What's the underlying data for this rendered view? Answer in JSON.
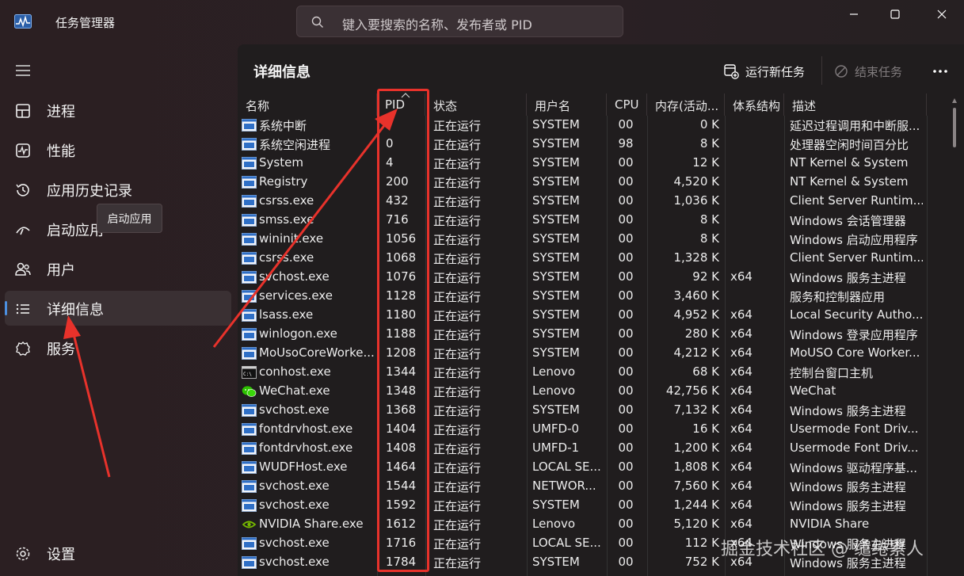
{
  "app": {
    "title": "任务管理器",
    "search_placeholder": "键入要搜索的名称、发布者或 PID"
  },
  "sidebar": {
    "items": [
      {
        "label": "进程",
        "icon": "processes-icon"
      },
      {
        "label": "性能",
        "icon": "performance-icon"
      },
      {
        "label": "应用历史记录",
        "icon": "app-history-icon"
      },
      {
        "label": "启动应用",
        "icon": "startup-icon"
      },
      {
        "label": "用户",
        "icon": "users-icon"
      },
      {
        "label": "详细信息",
        "icon": "details-icon",
        "active": true
      },
      {
        "label": "服务",
        "icon": "services-icon"
      }
    ],
    "settings_label": "设置",
    "tooltip": "启动应用"
  },
  "main": {
    "title": "详细信息",
    "run_task_label": "运行新任务",
    "end_task_label": "结束任务"
  },
  "table": {
    "columns": [
      "名称",
      "PID",
      "状态",
      "用户名",
      "CPU",
      "内存(活动...",
      "体系结构",
      "描述"
    ],
    "rows": [
      {
        "name": "系统中断",
        "pid": "",
        "status": "正在运行",
        "user": "SYSTEM",
        "cpu": "00",
        "mem": "0 K",
        "arch": "",
        "desc": "延迟过程调用和中断服...",
        "icon": "blue"
      },
      {
        "name": "系统空闲进程",
        "pid": "0",
        "status": "正在运行",
        "user": "SYSTEM",
        "cpu": "98",
        "mem": "8 K",
        "arch": "",
        "desc": "处理器空闲时间百分比",
        "icon": "blue"
      },
      {
        "name": "System",
        "pid": "4",
        "status": "正在运行",
        "user": "SYSTEM",
        "cpu": "00",
        "mem": "12 K",
        "arch": "",
        "desc": "NT Kernel & System",
        "icon": "blue"
      },
      {
        "name": "Registry",
        "pid": "200",
        "status": "正在运行",
        "user": "SYSTEM",
        "cpu": "00",
        "mem": "4,520 K",
        "arch": "",
        "desc": "NT Kernel & System",
        "icon": "blue"
      },
      {
        "name": "csrss.exe",
        "pid": "432",
        "status": "正在运行",
        "user": "SYSTEM",
        "cpu": "00",
        "mem": "1,036 K",
        "arch": "",
        "desc": "Client Server Runtim...",
        "icon": "blue"
      },
      {
        "name": "smss.exe",
        "pid": "716",
        "status": "正在运行",
        "user": "SYSTEM",
        "cpu": "00",
        "mem": "8 K",
        "arch": "",
        "desc": "Windows 会话管理器",
        "icon": "blue"
      },
      {
        "name": "wininit.exe",
        "pid": "1056",
        "status": "正在运行",
        "user": "SYSTEM",
        "cpu": "00",
        "mem": "8 K",
        "arch": "",
        "desc": "Windows 启动应用程序",
        "icon": "blue"
      },
      {
        "name": "csrss.exe",
        "pid": "1068",
        "status": "正在运行",
        "user": "SYSTEM",
        "cpu": "00",
        "mem": "1,328 K",
        "arch": "",
        "desc": "Client Server Runtim...",
        "icon": "blue"
      },
      {
        "name": "svchost.exe",
        "pid": "1076",
        "status": "正在运行",
        "user": "SYSTEM",
        "cpu": "00",
        "mem": "92 K",
        "arch": "x64",
        "desc": "Windows 服务主进程",
        "icon": "blue"
      },
      {
        "name": "services.exe",
        "pid": "1128",
        "status": "正在运行",
        "user": "SYSTEM",
        "cpu": "00",
        "mem": "3,460 K",
        "arch": "",
        "desc": "服务和控制器应用",
        "icon": "blue"
      },
      {
        "name": "lsass.exe",
        "pid": "1180",
        "status": "正在运行",
        "user": "SYSTEM",
        "cpu": "00",
        "mem": "4,952 K",
        "arch": "x64",
        "desc": "Local Security Autho...",
        "icon": "blue"
      },
      {
        "name": "winlogon.exe",
        "pid": "1188",
        "status": "正在运行",
        "user": "SYSTEM",
        "cpu": "00",
        "mem": "280 K",
        "arch": "x64",
        "desc": "Windows 登录应用程序",
        "icon": "blue"
      },
      {
        "name": "MoUsoCoreWorke...",
        "pid": "1208",
        "status": "正在运行",
        "user": "SYSTEM",
        "cpu": "00",
        "mem": "4,212 K",
        "arch": "x64",
        "desc": "MoUSO Core Worker...",
        "icon": "blue"
      },
      {
        "name": "conhost.exe",
        "pid": "1344",
        "status": "正在运行",
        "user": "Lenovo",
        "cpu": "00",
        "mem": "68 K",
        "arch": "x64",
        "desc": "控制台窗口主机",
        "icon": "console"
      },
      {
        "name": "WeChat.exe",
        "pid": "1348",
        "status": "正在运行",
        "user": "Lenovo",
        "cpu": "00",
        "mem": "42,756 K",
        "arch": "x64",
        "desc": "WeChat",
        "icon": "wechat"
      },
      {
        "name": "svchost.exe",
        "pid": "1368",
        "status": "正在运行",
        "user": "SYSTEM",
        "cpu": "00",
        "mem": "7,132 K",
        "arch": "x64",
        "desc": "Windows 服务主进程",
        "icon": "blue"
      },
      {
        "name": "fontdrvhost.exe",
        "pid": "1404",
        "status": "正在运行",
        "user": "UMFD-0",
        "cpu": "00",
        "mem": "16 K",
        "arch": "x64",
        "desc": "Usermode Font Driv...",
        "icon": "blue"
      },
      {
        "name": "fontdrvhost.exe",
        "pid": "1408",
        "status": "正在运行",
        "user": "UMFD-1",
        "cpu": "00",
        "mem": "1,200 K",
        "arch": "x64",
        "desc": "Usermode Font Driv...",
        "icon": "blue"
      },
      {
        "name": "WUDFHost.exe",
        "pid": "1464",
        "status": "正在运行",
        "user": "LOCAL SE...",
        "cpu": "00",
        "mem": "1,808 K",
        "arch": "x64",
        "desc": "Windows 驱动程序基...",
        "icon": "blue"
      },
      {
        "name": "svchost.exe",
        "pid": "1544",
        "status": "正在运行",
        "user": "NETWOR...",
        "cpu": "00",
        "mem": "7,560 K",
        "arch": "x64",
        "desc": "Windows 服务主进程",
        "icon": "blue"
      },
      {
        "name": "svchost.exe",
        "pid": "1592",
        "status": "正在运行",
        "user": "SYSTEM",
        "cpu": "00",
        "mem": "1,244 K",
        "arch": "x64",
        "desc": "Windows 服务主进程",
        "icon": "blue"
      },
      {
        "name": "NVIDIA Share.exe",
        "pid": "1612",
        "status": "正在运行",
        "user": "Lenovo",
        "cpu": "00",
        "mem": "5,120 K",
        "arch": "x64",
        "desc": "NVIDIA Share",
        "icon": "nvidia"
      },
      {
        "name": "svchost.exe",
        "pid": "1716",
        "status": "正在运行",
        "user": "LOCAL SE...",
        "cpu": "00",
        "mem": "112 K",
        "arch": "x64",
        "desc": "Windows 服务主进程",
        "icon": "blue"
      },
      {
        "name": "svchost.exe",
        "pid": "1784",
        "status": "正在运行",
        "user": "SYSTEM",
        "cpu": "00",
        "mem": "752 K",
        "arch": "x64",
        "desc": "Windows 服务主进程",
        "icon": "blue"
      }
    ]
  },
  "watermark": "掘金技术社区 @ 缱绻累人",
  "colors": {
    "annotation_red": "#e8322b",
    "accent_blue": "#4c8fe0"
  }
}
